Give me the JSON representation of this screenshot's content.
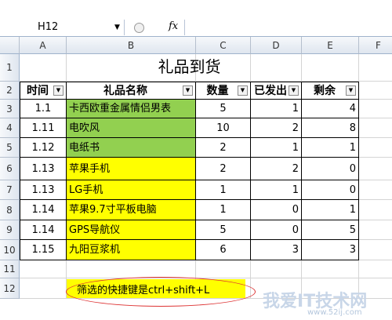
{
  "formula_bar": {
    "cell_ref": "H12",
    "fx": "fx",
    "value": ""
  },
  "columns": [
    "A",
    "B",
    "C",
    "D",
    "E",
    "F"
  ],
  "rows": [
    "1",
    "2",
    "3",
    "4",
    "5",
    "6",
    "7",
    "8",
    "9",
    "10",
    "11",
    "12"
  ],
  "title": "礼品到货",
  "headers": [
    "时间",
    "礼品名称",
    "数量",
    "已发出",
    "剩余"
  ],
  "table": [
    {
      "time": "1.1",
      "name": "卡西欧重金属情侣男表",
      "qty": "5",
      "sent": "1",
      "left": "4",
      "fill": "green"
    },
    {
      "time": "1.11",
      "name": "电吹风",
      "qty": "10",
      "sent": "2",
      "left": "8",
      "fill": "green"
    },
    {
      "time": "1.12",
      "name": "电纸书",
      "qty": "2",
      "sent": "1",
      "left": "1",
      "fill": "green"
    },
    {
      "time": "1.13",
      "name": "苹果手机",
      "qty": "2",
      "sent": "2",
      "left": "0",
      "fill": "yellow"
    },
    {
      "time": "1.13",
      "name": "LG手机",
      "qty": "1",
      "sent": "1",
      "left": "0",
      "fill": "yellow"
    },
    {
      "time": "1.14",
      "name": "苹果9.7寸平板电脑",
      "qty": "1",
      "sent": "0",
      "left": "1",
      "fill": "yellow"
    },
    {
      "time": "1.14",
      "name": "GPS导航仪",
      "qty": "5",
      "sent": "0",
      "left": "5",
      "fill": "yellow"
    },
    {
      "time": "1.15",
      "name": "九阳豆浆机",
      "qty": "6",
      "sent": "3",
      "left": "3",
      "fill": "yellow"
    }
  ],
  "note": "筛选的快捷键是ctrl+shift+L",
  "watermark": {
    "brand": "我爱IT技术网",
    "url": "www.52ij.com"
  },
  "colors": {
    "green": "#92d050",
    "yellow": "#ffff00",
    "ellipse": "#dd3333"
  }
}
